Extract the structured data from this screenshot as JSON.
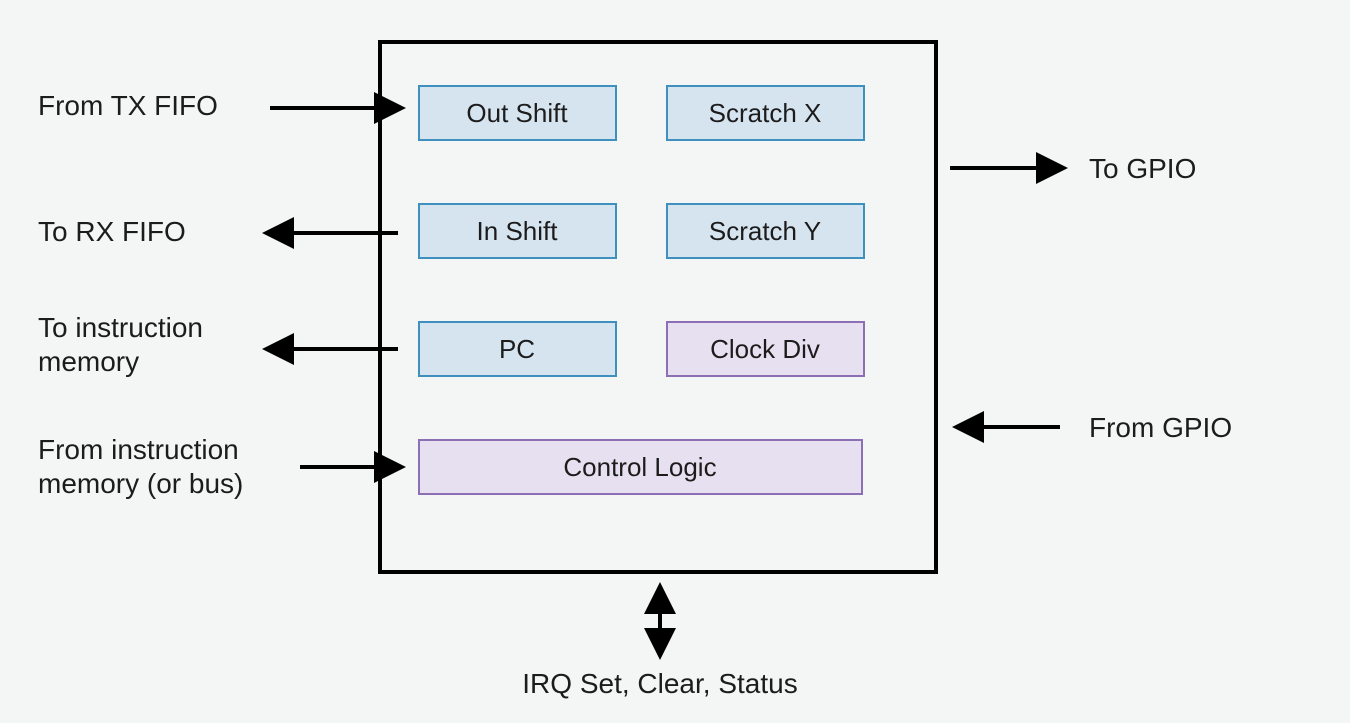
{
  "external_labels": {
    "tx_fifo": "From TX FIFO",
    "rx_fifo": "To RX FIFO",
    "to_instr_mem_line1": "To instruction",
    "to_instr_mem_line2": "memory",
    "from_instr_mem_line1": "From instruction",
    "from_instr_mem_line2": "memory (or bus)",
    "to_gpio": "To GPIO",
    "from_gpio": "From GPIO",
    "irq": "IRQ Set, Clear, Status"
  },
  "boxes": {
    "out_shift": "Out Shift",
    "scratch_x": "Scratch X",
    "in_shift": "In Shift",
    "scratch_y": "Scratch Y",
    "pc": "PC",
    "clock_div": "Clock Div",
    "control_logic": "Control Logic"
  }
}
